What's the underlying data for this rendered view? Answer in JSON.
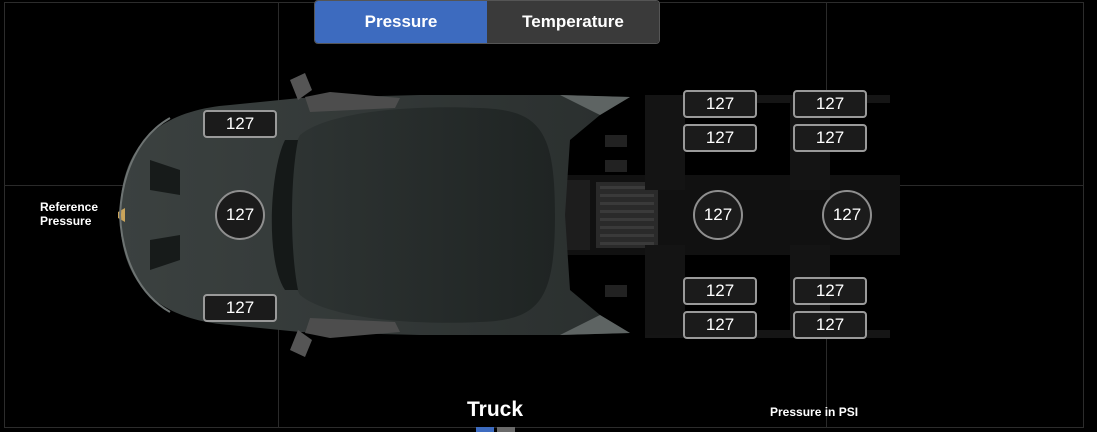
{
  "tabs": [
    {
      "label": "Pressure",
      "active": true
    },
    {
      "label": "Temperature",
      "active": false
    }
  ],
  "reference_label": "Reference\nPressure",
  "pressures": {
    "front_left": "127",
    "front_right": "127",
    "reference": "127",
    "drive_axle_1_center": "127",
    "drive_axle_2_center": "127",
    "axle1_top_outer": "127",
    "axle1_top_inner": "127",
    "axle2_top_outer": "127",
    "axle2_top_inner": "127",
    "axle1_bottom_inner": "127",
    "axle1_bottom_outer": "127",
    "axle2_bottom_inner": "127",
    "axle2_bottom_outer": "127"
  },
  "vehicle_title": "Truck",
  "units_label": "Pressure in PSI",
  "pager": {
    "active_color": "#3d6bbf",
    "inactive_color": "#6a6a6a"
  },
  "colors": {
    "accent": "#3d6bbf",
    "background": "#000000"
  }
}
